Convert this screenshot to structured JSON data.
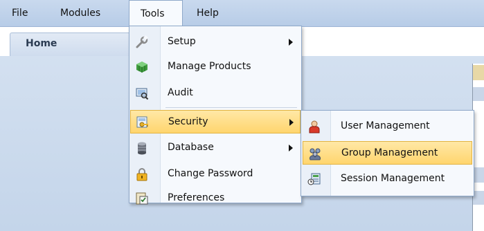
{
  "menubar": {
    "items": [
      {
        "label": "File"
      },
      {
        "label": "Modules"
      },
      {
        "label": "Tools"
      },
      {
        "label": "Help"
      }
    ]
  },
  "tabs": {
    "home_label": "Home"
  },
  "tools_menu": {
    "items": [
      {
        "label": "Setup",
        "icon": "wrench-icon",
        "has_submenu": true
      },
      {
        "label": "Manage Products",
        "icon": "cube-icon",
        "has_submenu": false
      },
      {
        "label": "Audit",
        "icon": "audit-monitor-icon",
        "has_submenu": false
      },
      {
        "label": "Security",
        "icon": "security-key-icon",
        "has_submenu": true,
        "highlighted": true
      },
      {
        "label": "Database",
        "icon": "database-icon",
        "has_submenu": true
      },
      {
        "label": "Change Password",
        "icon": "lock-icon",
        "has_submenu": false
      },
      {
        "label": "Preferences",
        "icon": "preferences-icon",
        "has_submenu": false
      }
    ]
  },
  "security_submenu": {
    "items": [
      {
        "label": "User Management",
        "icon": "user-icon"
      },
      {
        "label": "Group Management",
        "icon": "group-icon",
        "highlighted": true
      },
      {
        "label": "Session Management",
        "icon": "session-icon"
      }
    ]
  },
  "colors": {
    "highlight": "#ffd56e",
    "menu_bg": "#f6f9fd",
    "menubar_bg": "#b7cce7"
  }
}
